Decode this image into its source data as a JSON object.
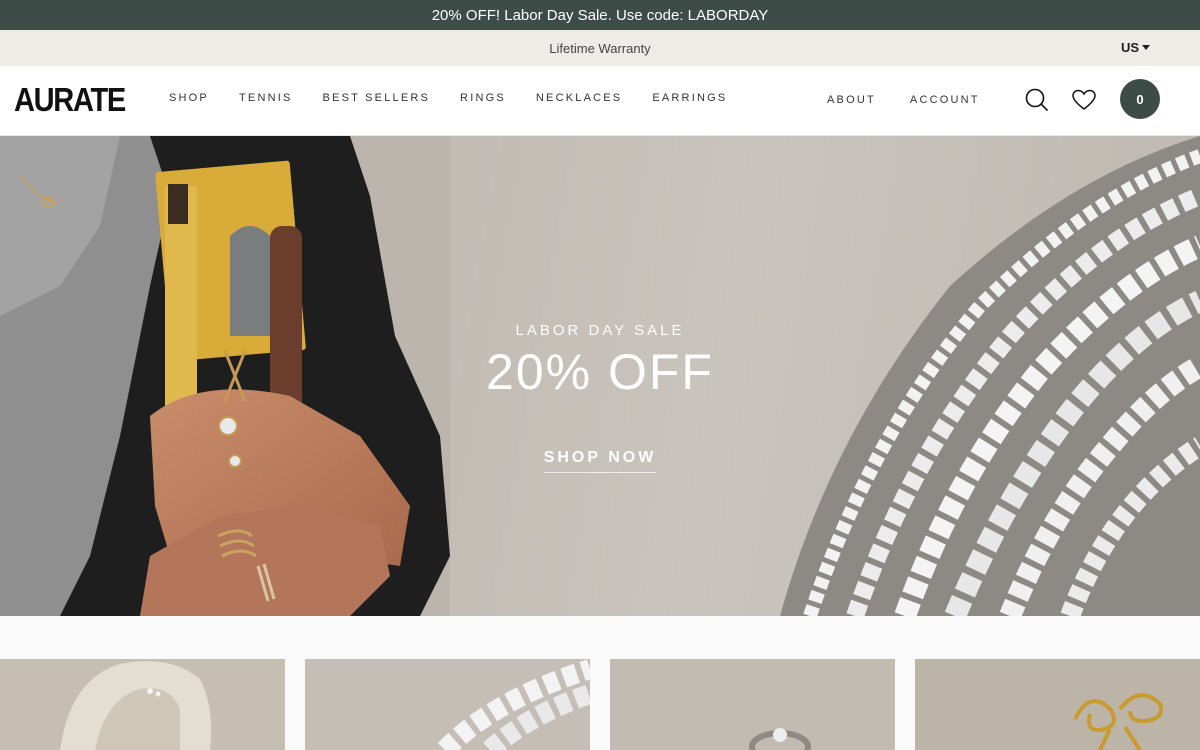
{
  "promo": {
    "text": "20% OFF! Labor Day Sale. Use code: LABORDAY"
  },
  "sub_bar": {
    "text": "Lifetime Warranty",
    "locale": "US"
  },
  "header": {
    "logo": "AURATE",
    "nav": [
      "SHOP",
      "TENNIS",
      "BEST SELLERS",
      "RINGS",
      "NECKLACES",
      "EARRINGS"
    ],
    "nav_right": [
      "ABOUT",
      "ACCOUNT"
    ],
    "cart_count": "0"
  },
  "hero": {
    "kicker": "LABOR DAY SALE",
    "title": "20% OFF",
    "cta": "SHOP NOW"
  },
  "colors": {
    "brand": "#3e4c47",
    "sub_bar": "#efebe7",
    "hero_bg": "#c3bdb6"
  },
  "icons": [
    "search-icon",
    "heart-icon",
    "caret-down-icon"
  ]
}
